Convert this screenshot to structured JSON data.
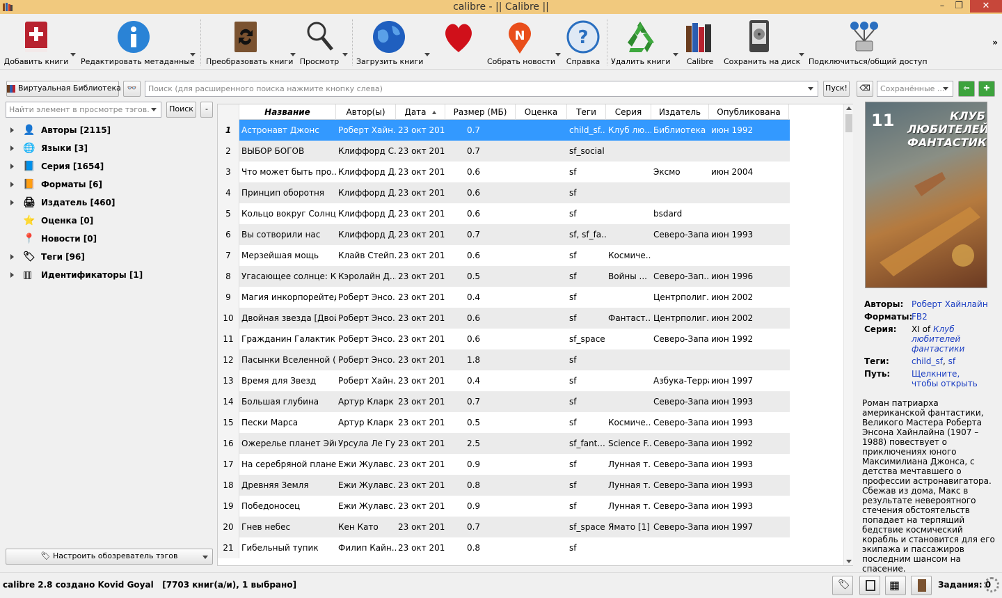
{
  "window": {
    "title": "calibre - || Calibre ||"
  },
  "toolbar": {
    "add_books": "Добавить книги",
    "edit_metadata": "Редактировать метаданные",
    "convert_books": "Преобразовать книги",
    "view": "Просмотр",
    "get_books": "Загрузить книги",
    "fetch_news": "Собрать новости",
    "help": "Справка",
    "remove_books": "Удалить книги",
    "library": "Calibre",
    "save_to_disk": "Сохранить на диск",
    "connect_share": "Подключиться/общий доступ",
    "more": "»"
  },
  "search": {
    "virtual_library": "Виртуальная Библиотека",
    "placeholder": "Поиск (для расширенного поиска нажмите кнопку слева)",
    "go": "Пуск!",
    "saved_searches_placeholder": "Сохранённые ..."
  },
  "tag_browser": {
    "find_placeholder": "Найти элемент в просмотре тэгов.",
    "find_button": "Поиск",
    "collapse_button": "-",
    "configure_button": "Настроить обозреватель тэгов",
    "nodes": [
      {
        "label": "Авторы [2115]",
        "expandable": true,
        "icon": "user-icon"
      },
      {
        "label": "Языки [3]",
        "expandable": true,
        "icon": "languages-icon"
      },
      {
        "label": "Серия [1654]",
        "expandable": true,
        "icon": "series-icon"
      },
      {
        "label": "Форматы [6]",
        "expandable": true,
        "icon": "book-icon"
      },
      {
        "label": "Издатель [460]",
        "expandable": true,
        "icon": "publisher-icon"
      },
      {
        "label": "Оценка [0]",
        "expandable": false,
        "icon": "star-icon"
      },
      {
        "label": "Новости [0]",
        "expandable": false,
        "icon": "news-icon"
      },
      {
        "label": "Теги [96]",
        "expandable": true,
        "icon": "tag-icon"
      },
      {
        "label": "Идентификаторы [1]",
        "expandable": true,
        "icon": "barcode-icon"
      }
    ]
  },
  "book_list": {
    "columns": [
      "Название",
      "Автор(ы)",
      "Дата",
      "Размер (МБ)",
      "Оценка",
      "Теги",
      "Серия",
      "Издатель",
      "Опубликована"
    ],
    "rows": [
      [
        "1",
        "Астронавт Джонс",
        "Роберт Хайн...",
        "23 окт 2014",
        "0.7",
        "",
        "child_sf...",
        "Клуб лю...",
        "Библиотека ...",
        "июн 1992"
      ],
      [
        "2",
        "ВЫБОР БОГОВ",
        "Клиффорд С...",
        "23 окт 2014",
        "0.7",
        "",
        "sf_social",
        "",
        "",
        ""
      ],
      [
        "3",
        "Что может быть про...",
        "Клиффорд Д...",
        "23 окт 2014",
        "0.6",
        "",
        "sf",
        "",
        "Эксмо",
        "июн 2004"
      ],
      [
        "4",
        "Принцип оборотня",
        "Клиффорд Д...",
        "23 окт 2014",
        "0.6",
        "",
        "sf",
        "",
        "",
        ""
      ],
      [
        "5",
        "Кольцо вокруг Солнца",
        "Клиффорд Д...",
        "23 окт 2014",
        "0.6",
        "",
        "sf",
        "",
        "bsdard",
        ""
      ],
      [
        "6",
        "Вы сотворили нас",
        "Клиффорд Д...",
        "23 окт 2014",
        "0.7",
        "",
        "sf, sf_fa...",
        "",
        "Северо-Запад",
        "июн 1993"
      ],
      [
        "7",
        "Мерзейшая мощь",
        "Клайв Стейп...",
        "23 окт 2014",
        "0.6",
        "",
        "sf",
        "Космиче...",
        "",
        ""
      ],
      [
        "8",
        "Угасающее солнце: К...",
        "Кэролайн Д...",
        "23 окт 2014",
        "0.5",
        "",
        "sf",
        "Войны ...",
        "Северо-Зап...",
        "июн 1996"
      ],
      [
        "9",
        "Магия инкорпорейтед",
        "Роберт Энсо...",
        "23 окт 2014",
        "0.4",
        "",
        "sf",
        "",
        "Центрполиг...",
        "июн 2002"
      ],
      [
        "10",
        "Двойная звезда [Двой...",
        "Роберт Энсо...",
        "23 окт 2014",
        "0.6",
        "",
        "sf",
        "Фантаст...",
        "Центрполиг...",
        "июн 2002"
      ],
      [
        "11",
        "Гражданин Галактики",
        "Роберт Энсо...",
        "23 окт 2014",
        "0.6",
        "",
        "sf_space",
        "",
        "Северо-Запад",
        "июн 1992"
      ],
      [
        "12",
        "Пасынки Вселенной (...",
        "Роберт Энсо...",
        "23 окт 2014",
        "1.8",
        "",
        "sf",
        "",
        "",
        ""
      ],
      [
        "13",
        "Время для Звезд",
        "Роберт Хайн...",
        "23 окт 2014",
        "0.4",
        "",
        "sf",
        "",
        "Азбука-Терра",
        "июн 1997"
      ],
      [
        "14",
        "Большая глубина",
        "Артур Кларк",
        "23 окт 2014",
        "0.7",
        "",
        "sf",
        "",
        "Северо-Запад",
        "июн 1993"
      ],
      [
        "15",
        "Пески Марса",
        "Артур Кларк",
        "23 окт 2014",
        "0.5",
        "",
        "sf",
        "Космиче...",
        "Северо-Запад",
        "июн 1993"
      ],
      [
        "16",
        "Ожерелье планет Эйк...",
        "Урсула Ле Гу...",
        "23 окт 2014",
        "2.5",
        "",
        "sf_fant...",
        "Science F...",
        "Северо-Запад",
        "июн 1992"
      ],
      [
        "17",
        "На серебряной планете",
        "Ежи Жулавс...",
        "23 окт 2014",
        "0.9",
        "",
        "sf",
        "Лунная т...",
        "Северо-Запад",
        "июн 1993"
      ],
      [
        "18",
        "Древняя Земля",
        "Ежи Жулавс...",
        "23 окт 2014",
        "0.8",
        "",
        "sf",
        "Лунная т...",
        "Северо-Запад",
        "июн 1993"
      ],
      [
        "19",
        "Победоносец",
        "Ежи Жулавс...",
        "23 окт 2014",
        "0.9",
        "",
        "sf",
        "Лунная т...",
        "Северо-Запад",
        "июн 1993"
      ],
      [
        "20",
        "Гнев небес",
        "Кен Като",
        "23 окт 2014",
        "0.7",
        "",
        "sf_space",
        "Ямато [1]",
        "Северо-Запад",
        "июн 1997"
      ],
      [
        "21",
        "Гибельный тупик",
        "Филип Кайн...",
        "23 окт 2014",
        "0.8",
        "",
        "sf",
        "",
        "",
        ""
      ]
    ],
    "selected_row": 0,
    "sorted_column": "Дата"
  },
  "book_details": {
    "cover_number": "11",
    "cover_title": "КЛУБ ЛЮБИТЕЛЕЙ ФАНТАСТИКИ",
    "authors_label": "Авторы:",
    "authors_value": "Роберт Хайнлайн",
    "formats_label": "Форматы:",
    "formats_value": "FB2",
    "series_label": "Серия:",
    "series_prefix": "XI of",
    "series_value": "Клуб любителей фантастики",
    "tags_label": "Теги:",
    "tags_value_1": "child_sf",
    "tags_value_2": "sf",
    "path_label": "Путь:",
    "path_value": "Щелкните, чтобы открыть",
    "comment": "Роман патриарха американской фантастики, Великого Мастера Роберта Энсона Хайнлайна (1907 – 1988) повествует о приключениях юного Максимилиана Джонса, с детства мечтавшего о профессии астронавигатора. Сбежав из дома, Макс в результате невероятного стечения обстоятельств попадает на терпящий бедствие космический корабль и становится для его экипажа и пассажиров последним шансом на спасение."
  },
  "status": {
    "left": "calibre 2.8 создано Kovid Goyal   [7703 книг(а/и), 1 выбрано]",
    "jobs": "Задания: 0"
  },
  "colors": {
    "selection": "#3399ff",
    "titlebar": "#f1c97e",
    "link": "#1a3dc2"
  }
}
